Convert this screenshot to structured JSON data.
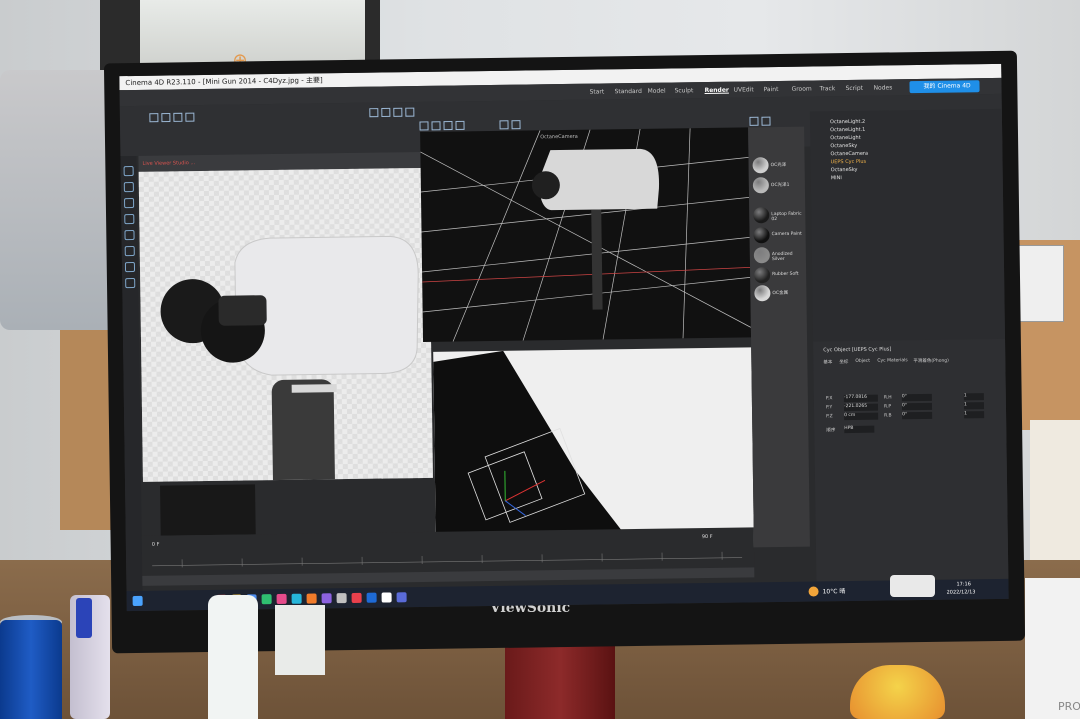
{
  "app": {
    "window_title": "Cinema 4D R23.110 - [Mini Gun 2014 - C4Dyz.jpg - 主要]",
    "menu": [
      "Start",
      "Standard",
      "Model",
      "Sculpt",
      "Render",
      "UVEdit",
      "Paint",
      "Groom",
      "Track",
      "Script",
      "Nodes"
    ],
    "active_layout": "Render",
    "user_button": "我的 Cinema 4D"
  },
  "viewports": {
    "render_toolbar": "Live Viewer Studio ...",
    "persp_label": "OctaneCamera"
  },
  "materials": [
    {
      "label": "OC光泽",
      "color": "#cfcfcf"
    },
    {
      "label": "OC光泽1",
      "color": "#b9b9b9"
    },
    {
      "label": "Laptop Fabric 02",
      "color": "#1a1a1a"
    },
    {
      "label": "Camera Paint",
      "color": "#101010"
    },
    {
      "label": "Anodized Silver",
      "color": "#8a8a8a"
    },
    {
      "label": "Rubber Soft",
      "color": "#222222"
    },
    {
      "label": "OC金属",
      "color": "#d8d8d8"
    }
  ],
  "objects": [
    "OctaneLight.2",
    "OctaneLight.1",
    "OctaneLight",
    "OctaneSky",
    "OctaneCamera",
    "UEPS Cyc Plus",
    "OctaneSky",
    "MINI"
  ],
  "attributes": {
    "header": "Cyc Object [UEPS Cyc Plus]",
    "tabs": [
      "基本",
      "坐标",
      "Object",
      "Cyc Materials",
      "平滑着色(Phong)"
    ],
    "coords": [
      {
        "axis": "P.X",
        "value": "-177.0816",
        "rot_axis": "R.H",
        "rot": "0°",
        "scale": "1"
      },
      {
        "axis": "P.Y",
        "value": "-221.0265",
        "rot_axis": "R.P",
        "rot": "0°",
        "scale": "1"
      },
      {
        "axis": "P.Z",
        "value": "0 cm",
        "rot_axis": "R.B",
        "rot": "0°",
        "scale": "1"
      }
    ],
    "order_label": "顺序",
    "order_value": "HPB"
  },
  "timeline": {
    "frame": "0 F",
    "end": "90 F"
  },
  "taskbar": {
    "weather": "10°C 晴",
    "time": "17:16",
    "date": "2022/12/13"
  },
  "monitor_brand": "ViewSonic",
  "box_text": "PRO"
}
